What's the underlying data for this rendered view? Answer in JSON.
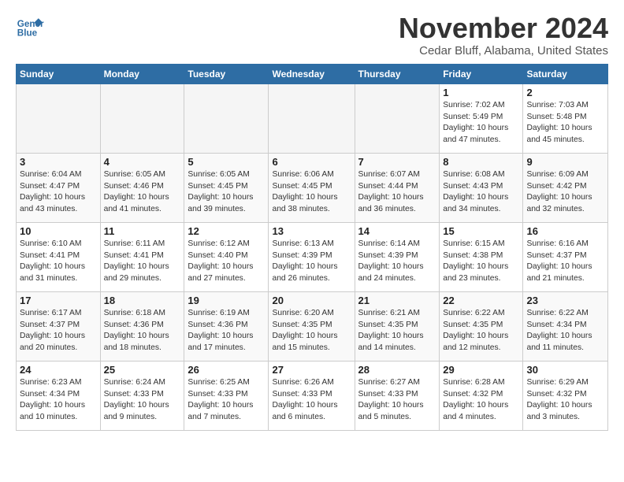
{
  "header": {
    "logo_line1": "General",
    "logo_line2": "Blue",
    "month": "November 2024",
    "location": "Cedar Bluff, Alabama, United States"
  },
  "days_of_week": [
    "Sunday",
    "Monday",
    "Tuesday",
    "Wednesday",
    "Thursday",
    "Friday",
    "Saturday"
  ],
  "weeks": [
    [
      {
        "day": "",
        "info": ""
      },
      {
        "day": "",
        "info": ""
      },
      {
        "day": "",
        "info": ""
      },
      {
        "day": "",
        "info": ""
      },
      {
        "day": "",
        "info": ""
      },
      {
        "day": "1",
        "info": "Sunrise: 7:02 AM\nSunset: 5:49 PM\nDaylight: 10 hours\nand 47 minutes."
      },
      {
        "day": "2",
        "info": "Sunrise: 7:03 AM\nSunset: 5:48 PM\nDaylight: 10 hours\nand 45 minutes."
      }
    ],
    [
      {
        "day": "3",
        "info": "Sunrise: 6:04 AM\nSunset: 4:47 PM\nDaylight: 10 hours\nand 43 minutes."
      },
      {
        "day": "4",
        "info": "Sunrise: 6:05 AM\nSunset: 4:46 PM\nDaylight: 10 hours\nand 41 minutes."
      },
      {
        "day": "5",
        "info": "Sunrise: 6:05 AM\nSunset: 4:45 PM\nDaylight: 10 hours\nand 39 minutes."
      },
      {
        "day": "6",
        "info": "Sunrise: 6:06 AM\nSunset: 4:45 PM\nDaylight: 10 hours\nand 38 minutes."
      },
      {
        "day": "7",
        "info": "Sunrise: 6:07 AM\nSunset: 4:44 PM\nDaylight: 10 hours\nand 36 minutes."
      },
      {
        "day": "8",
        "info": "Sunrise: 6:08 AM\nSunset: 4:43 PM\nDaylight: 10 hours\nand 34 minutes."
      },
      {
        "day": "9",
        "info": "Sunrise: 6:09 AM\nSunset: 4:42 PM\nDaylight: 10 hours\nand 32 minutes."
      }
    ],
    [
      {
        "day": "10",
        "info": "Sunrise: 6:10 AM\nSunset: 4:41 PM\nDaylight: 10 hours\nand 31 minutes."
      },
      {
        "day": "11",
        "info": "Sunrise: 6:11 AM\nSunset: 4:41 PM\nDaylight: 10 hours\nand 29 minutes."
      },
      {
        "day": "12",
        "info": "Sunrise: 6:12 AM\nSunset: 4:40 PM\nDaylight: 10 hours\nand 27 minutes."
      },
      {
        "day": "13",
        "info": "Sunrise: 6:13 AM\nSunset: 4:39 PM\nDaylight: 10 hours\nand 26 minutes."
      },
      {
        "day": "14",
        "info": "Sunrise: 6:14 AM\nSunset: 4:39 PM\nDaylight: 10 hours\nand 24 minutes."
      },
      {
        "day": "15",
        "info": "Sunrise: 6:15 AM\nSunset: 4:38 PM\nDaylight: 10 hours\nand 23 minutes."
      },
      {
        "day": "16",
        "info": "Sunrise: 6:16 AM\nSunset: 4:37 PM\nDaylight: 10 hours\nand 21 minutes."
      }
    ],
    [
      {
        "day": "17",
        "info": "Sunrise: 6:17 AM\nSunset: 4:37 PM\nDaylight: 10 hours\nand 20 minutes."
      },
      {
        "day": "18",
        "info": "Sunrise: 6:18 AM\nSunset: 4:36 PM\nDaylight: 10 hours\nand 18 minutes."
      },
      {
        "day": "19",
        "info": "Sunrise: 6:19 AM\nSunset: 4:36 PM\nDaylight: 10 hours\nand 17 minutes."
      },
      {
        "day": "20",
        "info": "Sunrise: 6:20 AM\nSunset: 4:35 PM\nDaylight: 10 hours\nand 15 minutes."
      },
      {
        "day": "21",
        "info": "Sunrise: 6:21 AM\nSunset: 4:35 PM\nDaylight: 10 hours\nand 14 minutes."
      },
      {
        "day": "22",
        "info": "Sunrise: 6:22 AM\nSunset: 4:35 PM\nDaylight: 10 hours\nand 12 minutes."
      },
      {
        "day": "23",
        "info": "Sunrise: 6:22 AM\nSunset: 4:34 PM\nDaylight: 10 hours\nand 11 minutes."
      }
    ],
    [
      {
        "day": "24",
        "info": "Sunrise: 6:23 AM\nSunset: 4:34 PM\nDaylight: 10 hours\nand 10 minutes."
      },
      {
        "day": "25",
        "info": "Sunrise: 6:24 AM\nSunset: 4:33 PM\nDaylight: 10 hours\nand 9 minutes."
      },
      {
        "day": "26",
        "info": "Sunrise: 6:25 AM\nSunset: 4:33 PM\nDaylight: 10 hours\nand 7 minutes."
      },
      {
        "day": "27",
        "info": "Sunrise: 6:26 AM\nSunset: 4:33 PM\nDaylight: 10 hours\nand 6 minutes."
      },
      {
        "day": "28",
        "info": "Sunrise: 6:27 AM\nSunset: 4:33 PM\nDaylight: 10 hours\nand 5 minutes."
      },
      {
        "day": "29",
        "info": "Sunrise: 6:28 AM\nSunset: 4:32 PM\nDaylight: 10 hours\nand 4 minutes."
      },
      {
        "day": "30",
        "info": "Sunrise: 6:29 AM\nSunset: 4:32 PM\nDaylight: 10 hours\nand 3 minutes."
      }
    ]
  ]
}
